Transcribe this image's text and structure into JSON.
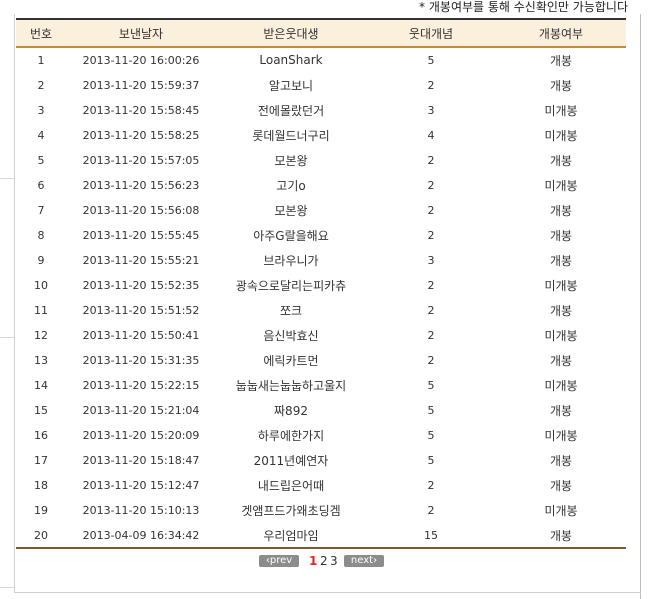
{
  "notice": "* 개봉여부를 통해 수신확인만 가능합니다",
  "columns": {
    "no": "번호",
    "date": "보낸날자",
    "recipient": "받은웃대생",
    "count": "웃대개념",
    "status": "개봉여부"
  },
  "rows": [
    {
      "no": "1",
      "date": "2013-11-20 16:00:26",
      "recipient": "LoanShark",
      "count": "5",
      "status": "개봉"
    },
    {
      "no": "2",
      "date": "2013-11-20 15:59:37",
      "recipient": "알고보니",
      "count": "2",
      "status": "개봉"
    },
    {
      "no": "3",
      "date": "2013-11-20 15:58:45",
      "recipient": "전에몰랐던거",
      "count": "3",
      "status": "미개봉"
    },
    {
      "no": "4",
      "date": "2013-11-20 15:58:25",
      "recipient": "롯데월드너구리",
      "count": "4",
      "status": "미개봉"
    },
    {
      "no": "5",
      "date": "2013-11-20 15:57:05",
      "recipient": "모본왕",
      "count": "2",
      "status": "개봉"
    },
    {
      "no": "6",
      "date": "2013-11-20 15:56:23",
      "recipient": "고기o",
      "count": "2",
      "status": "미개봉"
    },
    {
      "no": "7",
      "date": "2013-11-20 15:56:08",
      "recipient": "모본왕",
      "count": "2",
      "status": "개봉"
    },
    {
      "no": "8",
      "date": "2013-11-20 15:55:45",
      "recipient": "아주G랄을해요",
      "count": "2",
      "status": "개봉"
    },
    {
      "no": "9",
      "date": "2013-11-20 15:55:21",
      "recipient": "브라우니가",
      "count": "3",
      "status": "개봉"
    },
    {
      "no": "10",
      "date": "2013-11-20 15:52:35",
      "recipient": "광속으로달리는피카츄",
      "count": "2",
      "status": "미개봉"
    },
    {
      "no": "11",
      "date": "2013-11-20 15:51:52",
      "recipient": "쪼크",
      "count": "2",
      "status": "개봉"
    },
    {
      "no": "12",
      "date": "2013-11-20 15:50:41",
      "recipient": "음신박효신",
      "count": "2",
      "status": "미개봉"
    },
    {
      "no": "13",
      "date": "2013-11-20 15:31:35",
      "recipient": "에릭카트먼",
      "count": "2",
      "status": "개봉"
    },
    {
      "no": "14",
      "date": "2013-11-20 15:22:15",
      "recipient": "눕눕새는눕눕하고울지",
      "count": "5",
      "status": "미개봉"
    },
    {
      "no": "15",
      "date": "2013-11-20 15:21:04",
      "recipient": "짜892",
      "count": "5",
      "status": "개봉"
    },
    {
      "no": "16",
      "date": "2013-11-20 15:20:09",
      "recipient": "하루에한가지",
      "count": "5",
      "status": "미개봉"
    },
    {
      "no": "17",
      "date": "2013-11-20 15:18:47",
      "recipient": "2011년예연자",
      "count": "5",
      "status": "개봉"
    },
    {
      "no": "18",
      "date": "2013-11-20 15:12:47",
      "recipient": "내드립은어때",
      "count": "2",
      "status": "개봉"
    },
    {
      "no": "19",
      "date": "2013-11-20 15:10:13",
      "recipient": "겟앰프드가왜초딩겜",
      "count": "2",
      "status": "미개봉"
    },
    {
      "no": "20",
      "date": "2013-04-09 16:34:42",
      "recipient": "우리엄마임",
      "count": "15",
      "status": "개봉"
    }
  ],
  "pager": {
    "prev": "prev",
    "next": "next",
    "pages": [
      "1",
      "2",
      "3"
    ],
    "current": "1"
  },
  "colors": {
    "header_bg": "#fbf0dc",
    "header_border": "#c58a3c",
    "current_page": "#e0261b",
    "pager_button": "#8c8c8c"
  }
}
